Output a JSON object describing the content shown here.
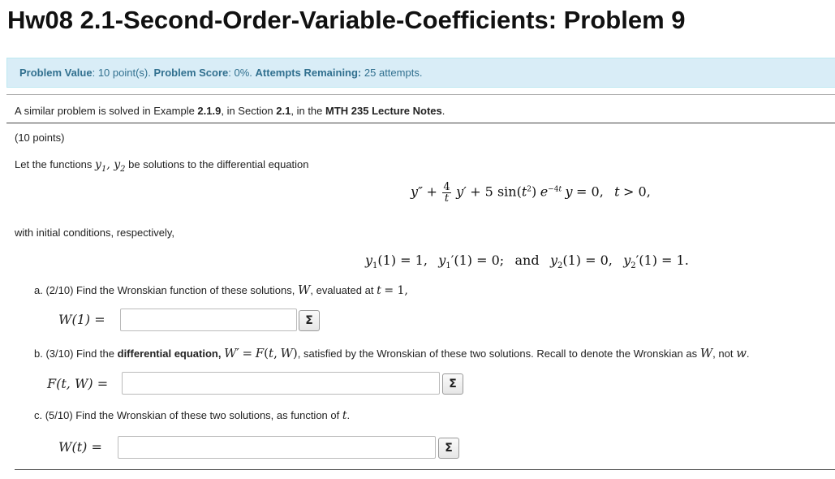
{
  "title": "Hw08 2.1-Second-Order-Variable-Coefficients: Problem 9",
  "status": {
    "value_label": "Problem Value",
    "value_text": "10 point(s).",
    "score_label": "Problem Score",
    "score_text": "0%.",
    "attempts_label": "Attempts Remaining:",
    "attempts_text": "25 attempts."
  },
  "reference": {
    "prefix": "A similar problem is solved in Example ",
    "example": "2.1.9",
    "mid": ", in Section ",
    "section": "2.1",
    "mid2": ", in the ",
    "notes": "MTH 235 Lecture Notes",
    "suffix": "."
  },
  "points": "(10 points)",
  "intro": "Let the functions",
  "intro_after": "be solutions to the differential equation",
  "with_ic": "with initial conditions, respectively,",
  "parts": {
    "a": {
      "text_before": "a. (2/10) Find the Wronskian function of these solutions,",
      "text_after": ", evaluated at",
      "label": "W(1) =",
      "value": ""
    },
    "b": {
      "text_before": "b. (3/10) Find the",
      "bold": "differential equation,",
      "text_mid": ", satisfied by the Wronskian of these two solutions. Recall to denote the Wronskian as",
      "text_after": ", not",
      "label": "F(t, W) =",
      "value": ""
    },
    "c": {
      "text_before": "c. (5/10) Find the Wronskian of these two solutions, as function of",
      "label": "W(t) =",
      "value": ""
    }
  },
  "sigma_label": "Σ"
}
